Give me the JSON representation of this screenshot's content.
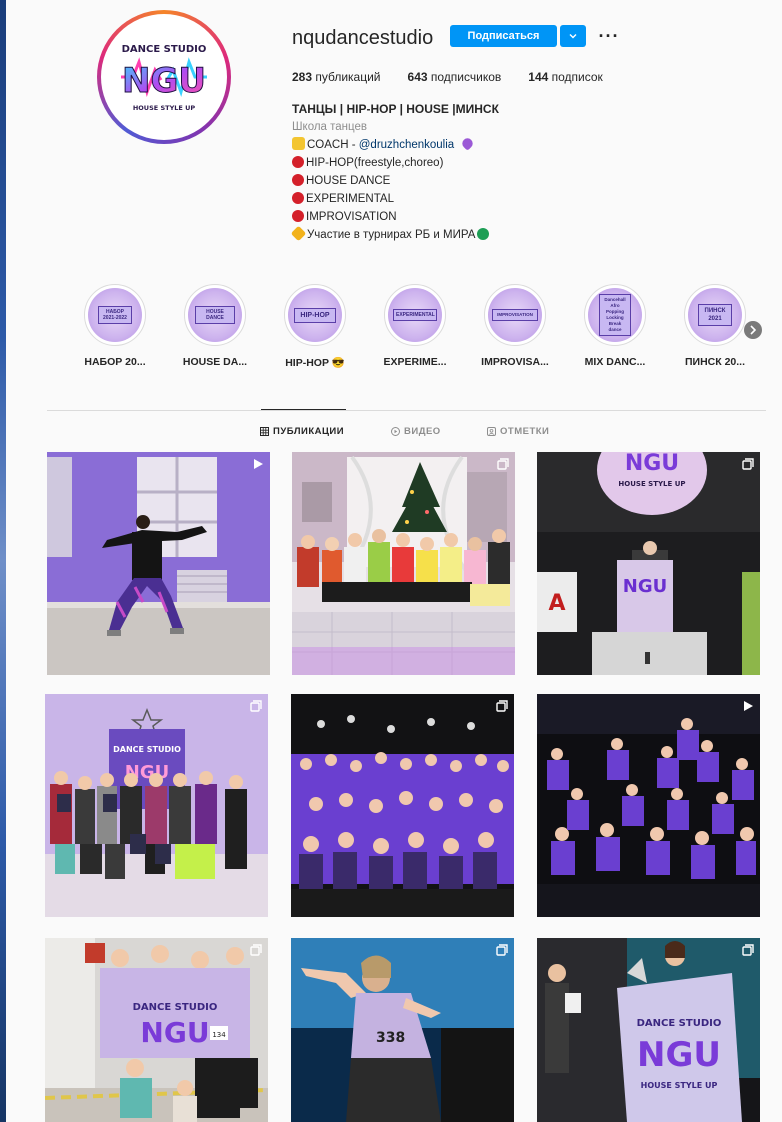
{
  "profile": {
    "username": "nqudancestudio",
    "follow_label": "Подписаться",
    "more_label": "···",
    "avatar": {
      "top_text": "DANCE STUDIO",
      "logo_text": "NGU",
      "bottom_text": "HOUSE STYLE UP"
    }
  },
  "stats": {
    "posts": "283",
    "posts_label": "публикаций",
    "followers": "643",
    "followers_label": "подписчиков",
    "following": "144",
    "following_label": "подписок"
  },
  "bio": {
    "name": "ТАНЦЫ | HIP-HOP | HOUSE |МИНСК",
    "category": "Школа танцев",
    "coach_prefix": "COACH - ",
    "coach_mention": "@druzhchenkoulia",
    "lines": [
      "HIP-HOP(freestyle,choreo)",
      "HOUSE DANCE",
      "EXPERIMENTAL",
      "IMPROVISATION"
    ],
    "tournament": "Участие в турнирах РБ и МИРА"
  },
  "highlights": [
    {
      "label": "НАБОР 20...",
      "cover": "НАБОР 2021-2022"
    },
    {
      "label": "HOUSE DA...",
      "cover": "HOUSE DANCE"
    },
    {
      "label": "HIP-HOP 😎",
      "cover": "HIP-HOP"
    },
    {
      "label": "EXPERIME...",
      "cover": "EXPERIMENTAL"
    },
    {
      "label": "IMPROVISA...",
      "cover": "IMPROVISATION"
    },
    {
      "label": "MIX DANC...",
      "cover": "Dancehall Afro Popping Locking Break dance"
    },
    {
      "label": "ПИНСК 20...",
      "cover": "ПИНСК 2021"
    }
  ],
  "tabs": [
    {
      "label": "ПУБЛИКАЦИИ",
      "icon": "grid-icon",
      "active": true
    },
    {
      "label": "ВИДЕО",
      "icon": "play-circle-icon",
      "active": false
    },
    {
      "label": "ОТМЕТКИ",
      "icon": "tag-icon",
      "active": false
    }
  ],
  "posts": [
    {
      "kind": "video",
      "scene": "dancer in purple studio"
    },
    {
      "kind": "carousel",
      "scene": "christmas group photo"
    },
    {
      "kind": "carousel",
      "scene": "stage podium with banner"
    },
    {
      "kind": "carousel",
      "scene": "kids with diplomas"
    },
    {
      "kind": "carousel",
      "scene": "large group in purple shirts"
    },
    {
      "kind": "video",
      "scene": "group posing on stage"
    },
    {
      "kind": "carousel",
      "scene": "team with studio flag"
    },
    {
      "kind": "carousel",
      "scene": "dancer on stage"
    },
    {
      "kind": "carousel",
      "scene": "award with banner"
    }
  ],
  "banner": {
    "number_1": "134",
    "number_2": "338",
    "tag_A": "A"
  },
  "colors": {
    "accent": "#0095f6",
    "purple": "#6a3fd0",
    "dot_red": "#d4202a"
  }
}
